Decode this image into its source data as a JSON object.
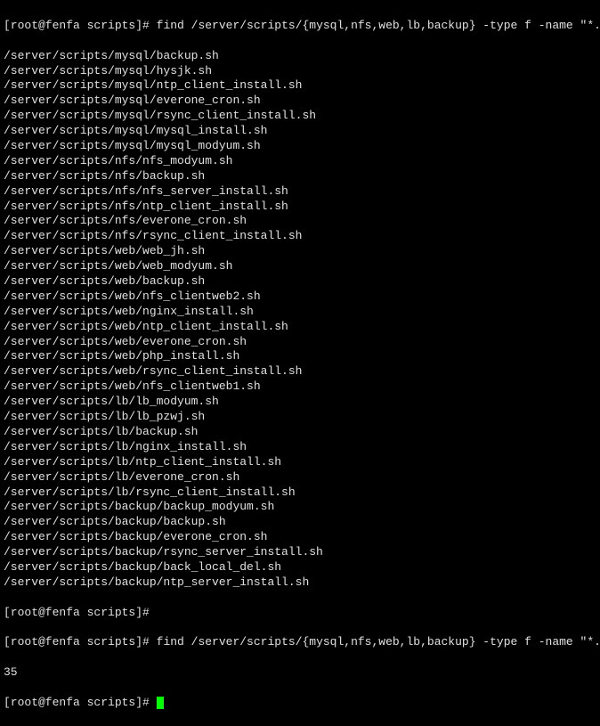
{
  "terminal": {
    "prompt1": "[root@fenfa scripts]# ",
    "command1": "find /server/scripts/{mysql,nfs,web,lb,backup} -type f -name \"*.sh\"",
    "output": [
      "/server/scripts/mysql/backup.sh",
      "/server/scripts/mysql/hysjk.sh",
      "/server/scripts/mysql/ntp_client_install.sh",
      "/server/scripts/mysql/everone_cron.sh",
      "/server/scripts/mysql/rsync_client_install.sh",
      "/server/scripts/mysql/mysql_install.sh",
      "/server/scripts/mysql/mysql_modyum.sh",
      "/server/scripts/nfs/nfs_modyum.sh",
      "/server/scripts/nfs/backup.sh",
      "/server/scripts/nfs/nfs_server_install.sh",
      "/server/scripts/nfs/ntp_client_install.sh",
      "/server/scripts/nfs/everone_cron.sh",
      "/server/scripts/nfs/rsync_client_install.sh",
      "/server/scripts/web/web_jh.sh",
      "/server/scripts/web/web_modyum.sh",
      "/server/scripts/web/backup.sh",
      "/server/scripts/web/nfs_clientweb2.sh",
      "/server/scripts/web/nginx_install.sh",
      "/server/scripts/web/ntp_client_install.sh",
      "/server/scripts/web/everone_cron.sh",
      "/server/scripts/web/php_install.sh",
      "/server/scripts/web/rsync_client_install.sh",
      "/server/scripts/web/nfs_clientweb1.sh",
      "/server/scripts/lb/lb_modyum.sh",
      "/server/scripts/lb/lb_pzwj.sh",
      "/server/scripts/lb/backup.sh",
      "/server/scripts/lb/nginx_install.sh",
      "/server/scripts/lb/ntp_client_install.sh",
      "/server/scripts/lb/everone_cron.sh",
      "/server/scripts/lb/rsync_client_install.sh",
      "/server/scripts/backup/backup_modyum.sh",
      "/server/scripts/backup/backup.sh",
      "/server/scripts/backup/everone_cron.sh",
      "/server/scripts/backup/rsync_server_install.sh",
      "/server/scripts/backup/back_local_del.sh",
      "/server/scripts/backup/ntp_server_install.sh"
    ],
    "prompt2": "[root@fenfa scripts]#",
    "prompt3": "[root@fenfa scripts]# ",
    "command2": "find /server/scripts/{mysql,nfs,web,lb,backup} -type f -name \"*.sh\"|wc -l",
    "output2": "35",
    "prompt4": "[root@fenfa scripts]# "
  }
}
